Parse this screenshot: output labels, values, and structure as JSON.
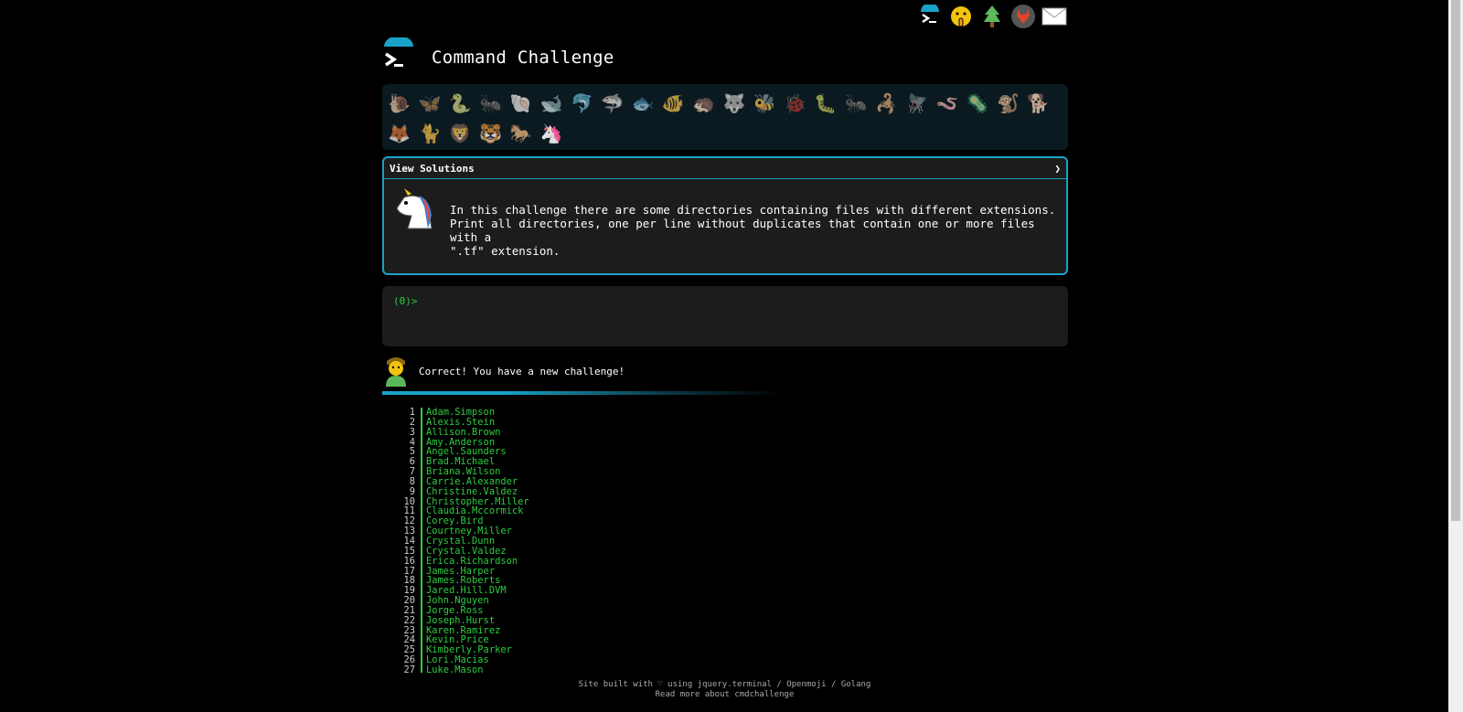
{
  "header": {
    "title": "Command Challenge"
  },
  "top_icons": [
    "terminal-icon",
    "shush-face-icon",
    "tree-icon",
    "gitlab-icon",
    "mail-icon"
  ],
  "panel": {
    "title": "View Solutions",
    "chevron": "❯",
    "description": "In this challenge there are some directories containing files with different extensions.\nPrint all directories, one per line without duplicates that contain one or more files with a\n\".tf\" extension."
  },
  "terminal": {
    "prompt": "(0)>"
  },
  "status": {
    "message": "Correct! You have a new challenge!"
  },
  "listing": [
    {
      "n": "1",
      "name": "Adam.Simpson"
    },
    {
      "n": "2",
      "name": "Alexis.Stein"
    },
    {
      "n": "3",
      "name": "Allison.Brown"
    },
    {
      "n": "4",
      "name": "Amy.Anderson"
    },
    {
      "n": "5",
      "name": "Angel.Saunders"
    },
    {
      "n": "6",
      "name": "Brad.Michael"
    },
    {
      "n": "7",
      "name": "Briana.Wilson"
    },
    {
      "n": "8",
      "name": "Carrie.Alexander"
    },
    {
      "n": "9",
      "name": "Christine.Valdez"
    },
    {
      "n": "10",
      "name": "Christopher.Miller"
    },
    {
      "n": "11",
      "name": "Claudia.Mccormick"
    },
    {
      "n": "12",
      "name": "Corey.Bird"
    },
    {
      "n": "13",
      "name": "Courtney.Miller"
    },
    {
      "n": "14",
      "name": "Crystal.Dunn"
    },
    {
      "n": "15",
      "name": "Crystal.Valdez"
    },
    {
      "n": "16",
      "name": "Erica.Richardson"
    },
    {
      "n": "17",
      "name": "James.Harper"
    },
    {
      "n": "18",
      "name": "James.Roberts"
    },
    {
      "n": "19",
      "name": "Jared.Hill.DVM"
    },
    {
      "n": "20",
      "name": "John.Nguyen"
    },
    {
      "n": "21",
      "name": "Jorge.Ross"
    },
    {
      "n": "22",
      "name": "Joseph.Hurst"
    },
    {
      "n": "23",
      "name": "Karen.Ramirez"
    },
    {
      "n": "24",
      "name": "Kevin.Price"
    },
    {
      "n": "25",
      "name": "Kimberly.Parker"
    },
    {
      "n": "26",
      "name": "Lori.Macias"
    },
    {
      "n": "27",
      "name": "Luke.Mason"
    }
  ],
  "footer": {
    "line1": "Site built with ♡ using jquery.terminal / Openmoji / Golang",
    "line2": "Read more about cmdchallenge"
  },
  "levels": [
    "snail",
    "butterfly",
    "snake",
    "bug",
    "shell",
    "whale",
    "dolphin",
    "shark",
    "fish",
    "tropical-fish",
    "hedgehog",
    "wolf",
    "bee",
    "ladybug",
    "caterpillar",
    "ant",
    "scorpion",
    "fly",
    "worm",
    "microbe",
    "monkey",
    "dog",
    "fox",
    "cat",
    "lion",
    "tiger",
    "horse",
    "unicorn"
  ],
  "colors": {
    "accent": "#1aa3c8",
    "prompt": "#2ecc40",
    "panel_bg": "#1c1c1c"
  }
}
